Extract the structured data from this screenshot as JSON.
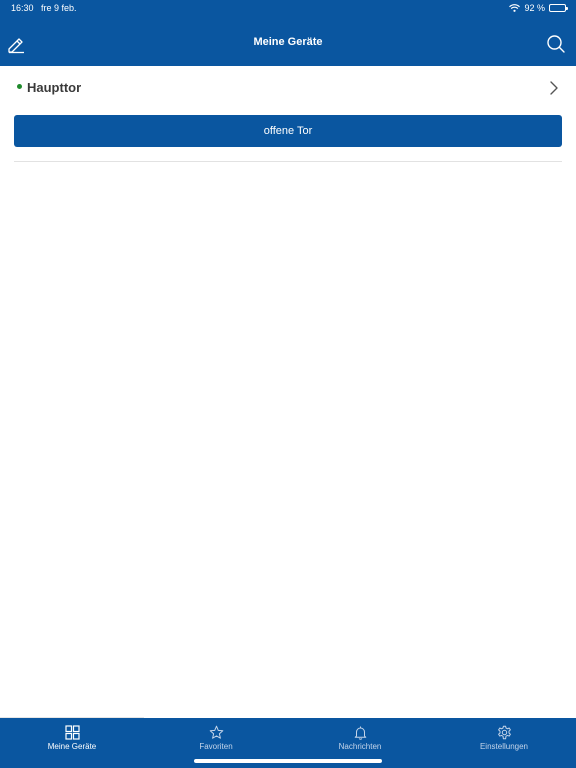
{
  "status_bar": {
    "time": "16:30",
    "date": "fre 9 feb.",
    "battery": "92 %",
    "battery_level": 0.92
  },
  "header": {
    "title": "Meine Geräte",
    "left_icon": "pencil-icon",
    "right_icon": "search-icon",
    "background": "#0a56a0"
  },
  "device": {
    "name": "Haupttor",
    "status_color": "#1f8a2c",
    "action_label": "offene Tor"
  },
  "tabs": [
    {
      "label": "Meine Geräte",
      "icon": "grid-icon",
      "active": true
    },
    {
      "label": "Favoriten",
      "icon": "star-icon",
      "active": false
    },
    {
      "label": "Nachrichten",
      "icon": "bell-icon",
      "active": false
    },
    {
      "label": "Einstellungen",
      "icon": "gear-icon",
      "active": false
    }
  ]
}
